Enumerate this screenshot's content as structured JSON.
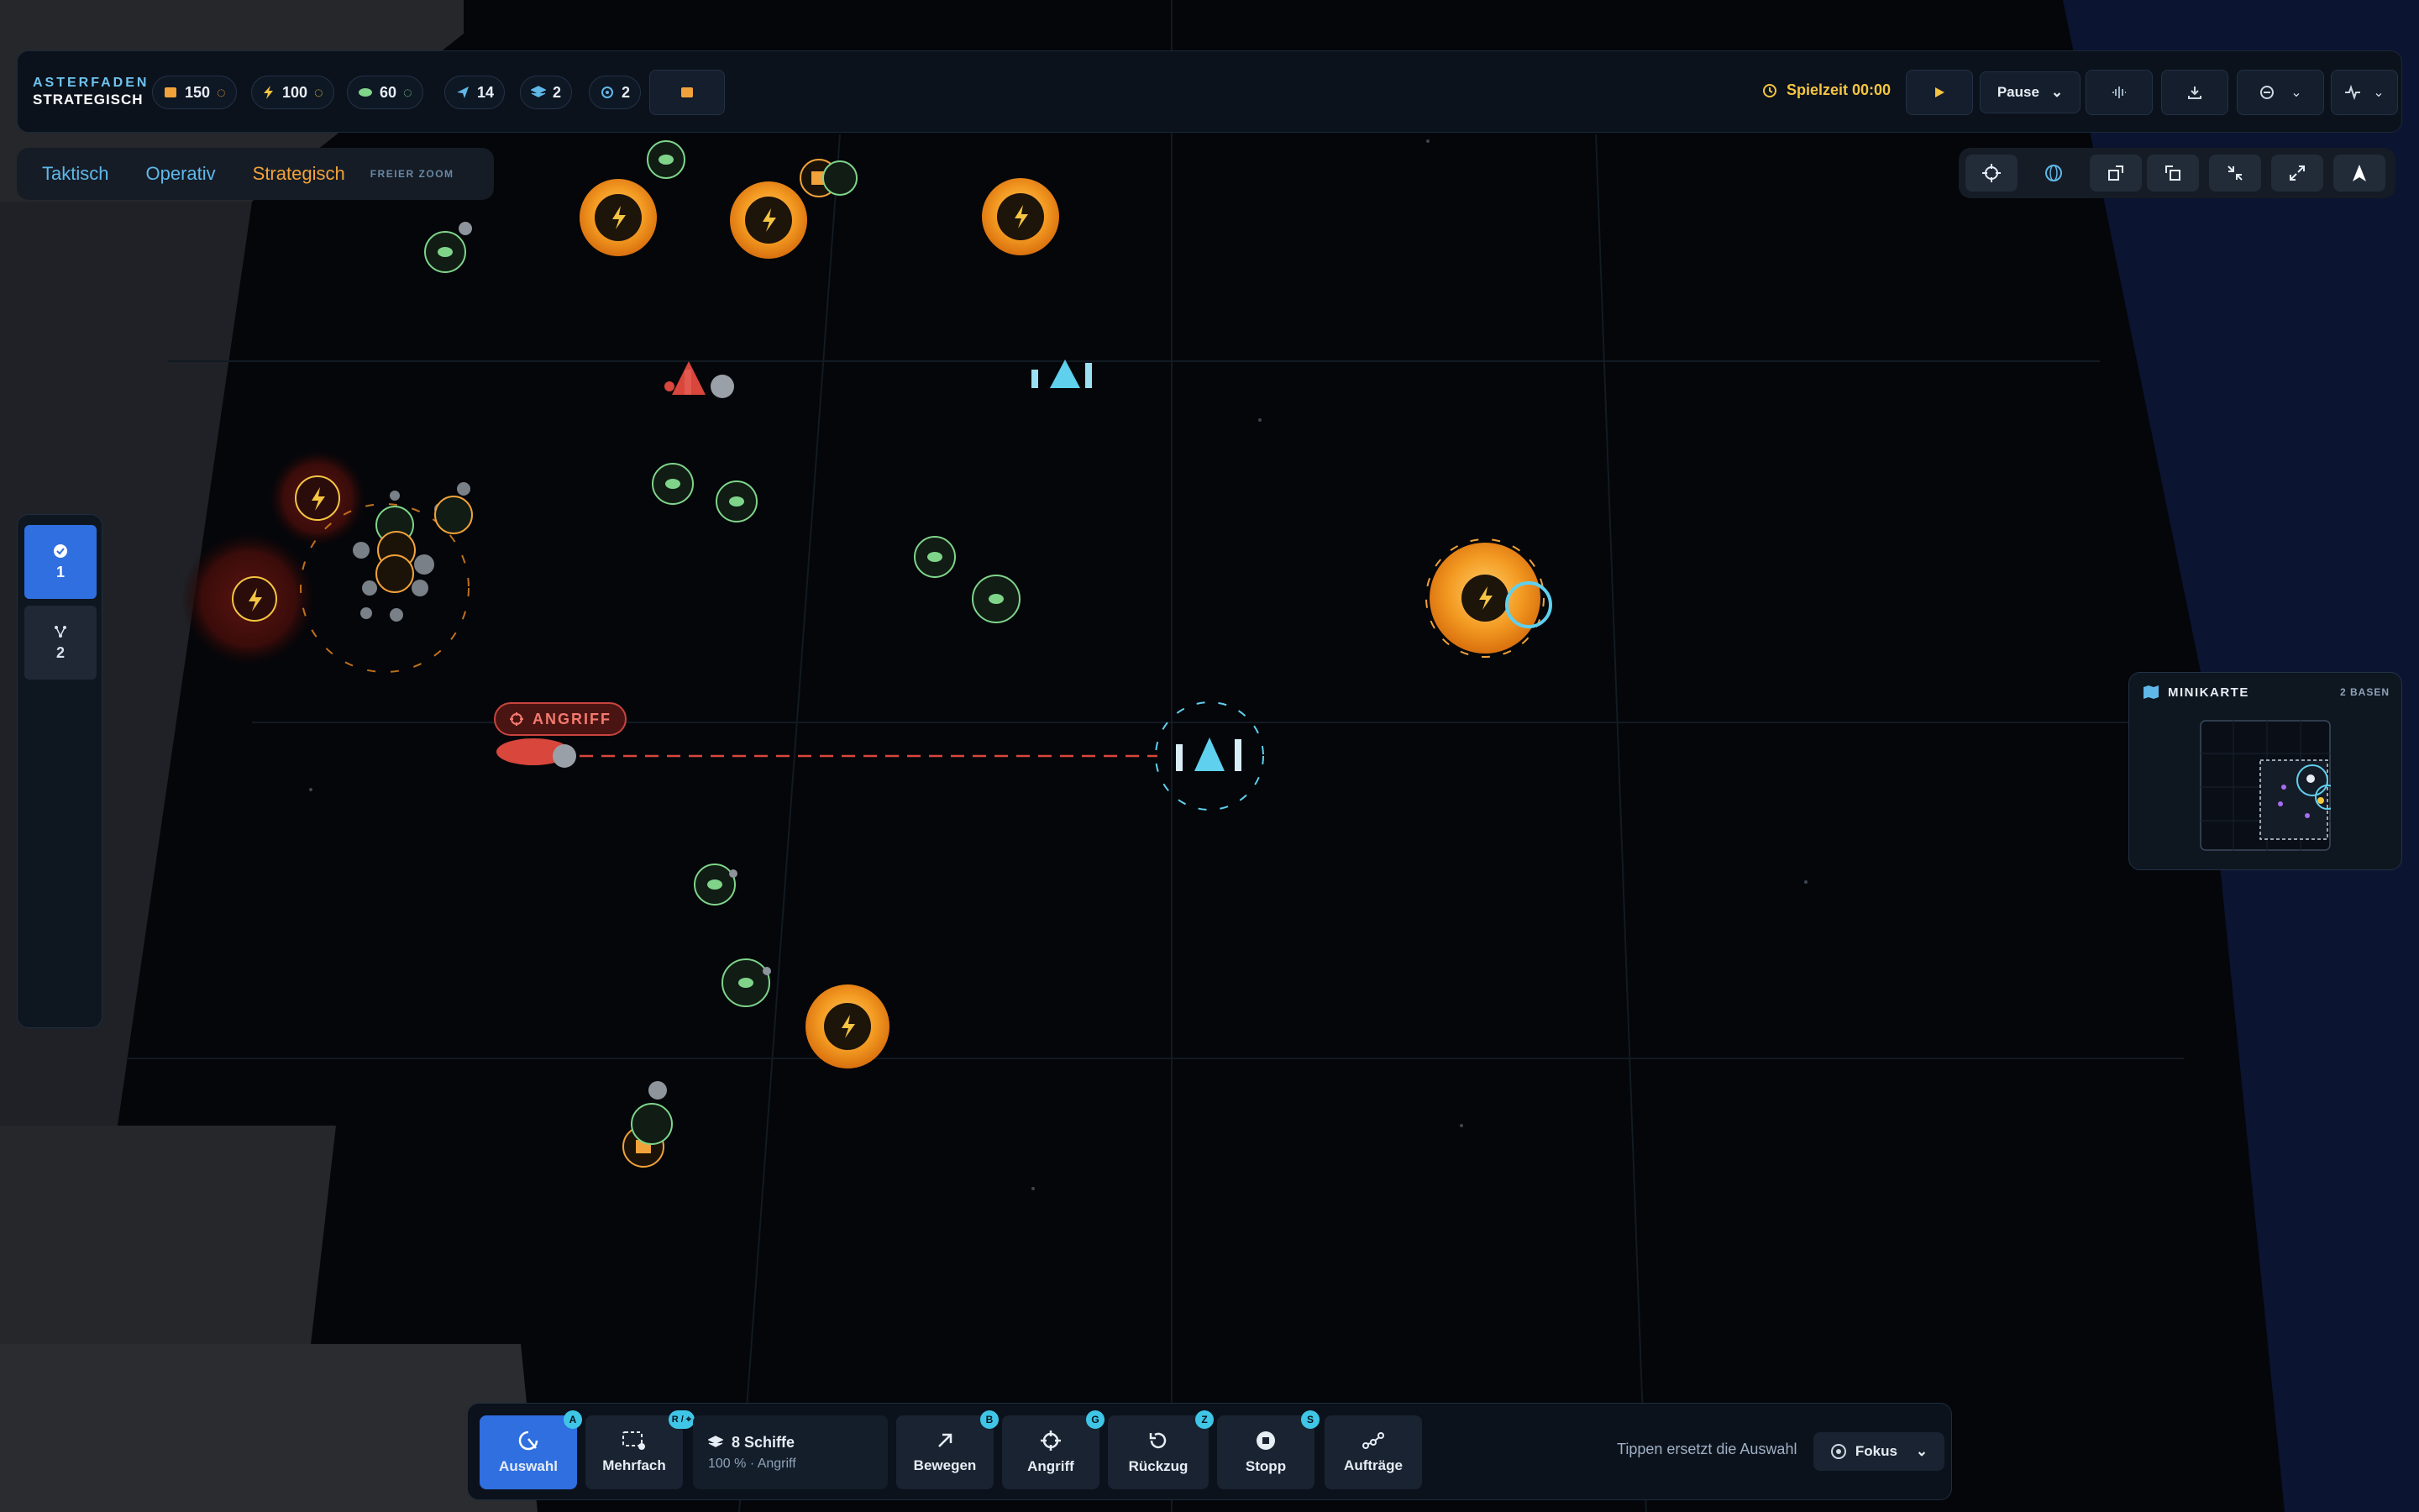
{
  "app": {
    "title_line1": "ASTERFADEN",
    "title_line2": "STRATEGISCH"
  },
  "resources": [
    {
      "name": "crates-icon",
      "value": "150",
      "color": "#f1a23a"
    },
    {
      "name": "energy-icon",
      "value": "100",
      "color": "#f5c542"
    },
    {
      "name": "biomass-icon",
      "value": "60",
      "color": "#7fd48a"
    }
  ],
  "stats": [
    {
      "name": "fleet-icon",
      "value": "14"
    },
    {
      "name": "stack-icon",
      "value": "2"
    },
    {
      "name": "target-icon",
      "value": "2"
    }
  ],
  "clock": {
    "label": "Spielzeit 00:00",
    "speed_label": "Pause"
  },
  "mode_tabs": {
    "tactical": "Taktisch",
    "operative": "Operativ",
    "strategic": "Strategisch",
    "free_zoom": "FREIER ZOOM",
    "active": "Strategisch"
  },
  "groups": [
    {
      "label": "1",
      "icon": "check-icon",
      "active": true
    },
    {
      "label": "2",
      "icon": "network-icon",
      "active": false
    }
  ],
  "minimap": {
    "title": "MINIKARTE",
    "bases": "2 BASEN"
  },
  "battle": {
    "attack_label": "ANGRIFF"
  },
  "command_bar": {
    "select": {
      "label": "Auswahl",
      "key": "A"
    },
    "multi": {
      "label": "Mehrfach",
      "key": "R / ⌖"
    },
    "ships": {
      "count": "8 Schiffe",
      "detail": "100 % · Angriff"
    },
    "move": {
      "label": "Bewegen",
      "key": "B"
    },
    "attack": {
      "label": "Angriff",
      "key": "G"
    },
    "retreat": {
      "label": "Rückzug",
      "key": "Z"
    },
    "stop": {
      "label": "Stopp",
      "key": "S"
    },
    "orders": {
      "label": "Aufträge"
    },
    "hint": "Tippen ersetzt die Auswahl",
    "focus": "Fokus"
  },
  "colors": {
    "accent_blue": "#2f6fe0",
    "energy_orange": "#f1a23a",
    "biomass_green": "#7fd48a",
    "enemy_red": "#d8463c",
    "ally_cyan": "#5fd0ee"
  }
}
